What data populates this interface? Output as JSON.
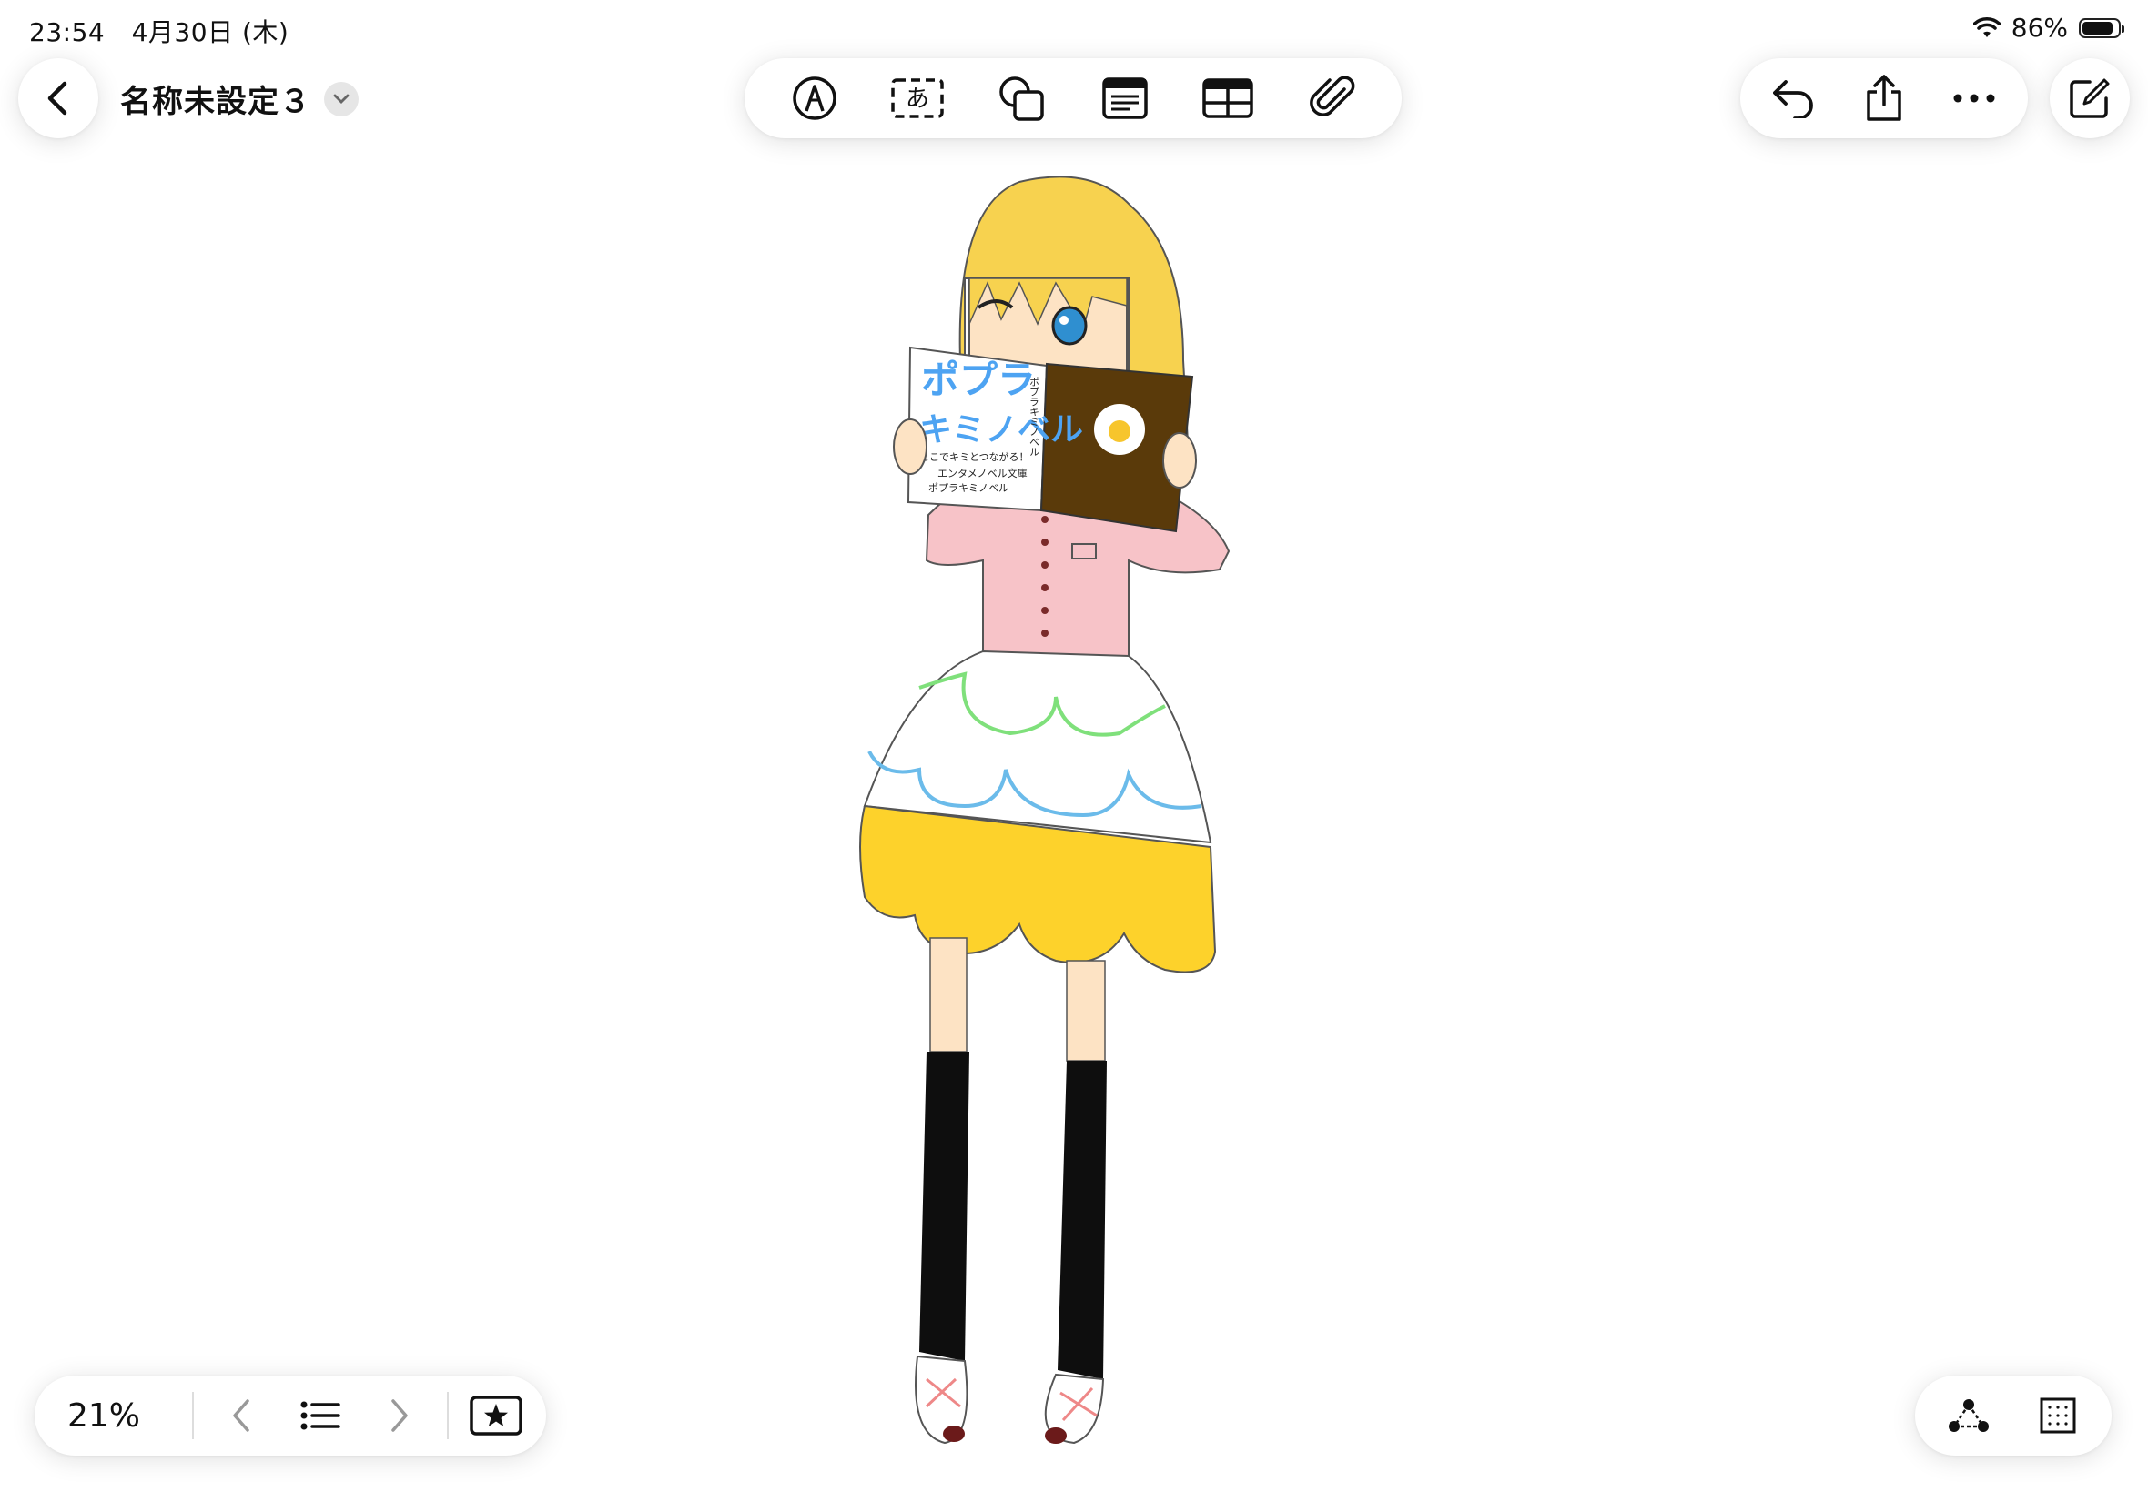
{
  "status": {
    "time": "23:54",
    "date": "4月30日 (木)",
    "battery": "86%",
    "battery_level": 0.86
  },
  "header": {
    "title": "名称未設定３"
  },
  "toolbar": {
    "tools": [
      "pen-tip-icon",
      "text-box-icon",
      "shapes-icon",
      "note-icon",
      "table-icon",
      "paperclip-icon"
    ]
  },
  "right_actions": [
    "undo-icon",
    "share-icon",
    "more-icon"
  ],
  "footer": {
    "zoom": "21%"
  },
  "artwork": {
    "book_title_1": "ポプラ",
    "book_title_2": "キミノベル",
    "book_sub_1": "ここでキミとつながる！",
    "book_sub_2": "エンタメノベル文庫",
    "book_sub_3": "ポプラキミノベル",
    "book_spine": "ポプラキミノベル",
    "colors": {
      "hair": "#f7d24f",
      "top": "#f7c3c8",
      "skirt": "#ffffff",
      "hem": "#fdd22b",
      "socks": "#0e0e0e",
      "book_cover": "#5a3a0a",
      "title_blue": "#4da3f2"
    }
  }
}
